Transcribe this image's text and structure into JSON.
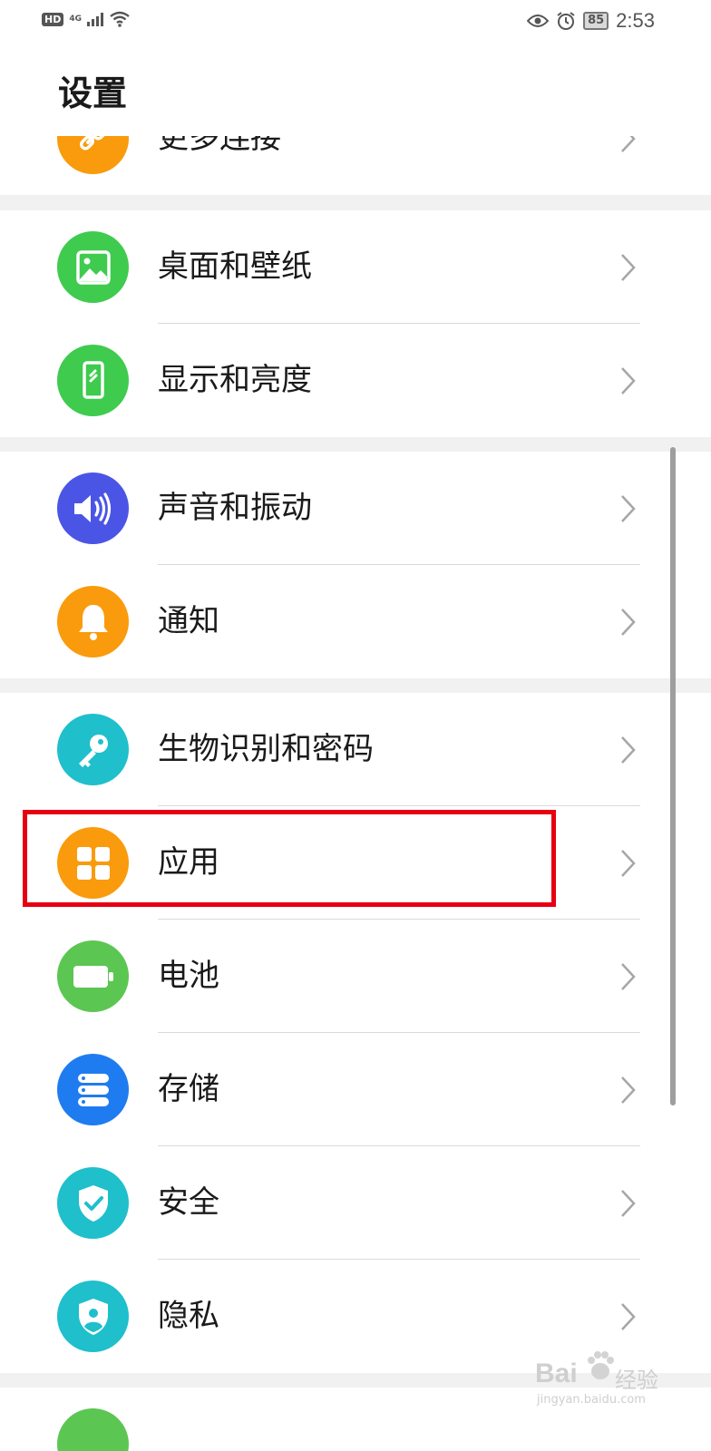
{
  "status_bar": {
    "hd": "HD",
    "network": "4G",
    "battery": "85",
    "time": "2:53"
  },
  "page": {
    "title": "设置"
  },
  "settings": {
    "more_connections": {
      "label": "更多连接",
      "icon": "link-icon",
      "color": "#F99B0C"
    },
    "desktop_wallpaper": {
      "label": "桌面和壁纸",
      "icon": "image-icon",
      "color": "#3FCB4E"
    },
    "display_brightness": {
      "label": "显示和亮度",
      "icon": "phone-screen-icon",
      "color": "#3FCB4E"
    },
    "sound_vibration": {
      "label": "声音和振动",
      "icon": "speaker-icon",
      "color": "#4A55E6"
    },
    "notifications": {
      "label": "通知",
      "icon": "bell-icon",
      "color": "#F99B0C"
    },
    "biometrics_password": {
      "label": "生物识别和密码",
      "icon": "key-icon",
      "color": "#1FBFCC"
    },
    "apps": {
      "label": "应用",
      "icon": "apps-grid-icon",
      "color": "#F99B0C"
    },
    "battery": {
      "label": "电池",
      "icon": "battery-icon",
      "color": "#5CC653"
    },
    "storage": {
      "label": "存储",
      "icon": "storage-icon",
      "color": "#1F7CF0"
    },
    "security": {
      "label": "安全",
      "icon": "shield-check-icon",
      "color": "#1FBFCC"
    },
    "privacy": {
      "label": "隐私",
      "icon": "privacy-shield-icon",
      "color": "#1FBFCC"
    }
  },
  "watermark": {
    "brand": "Bai",
    "suffix": "经验",
    "url": "jingyan.baidu.com"
  }
}
